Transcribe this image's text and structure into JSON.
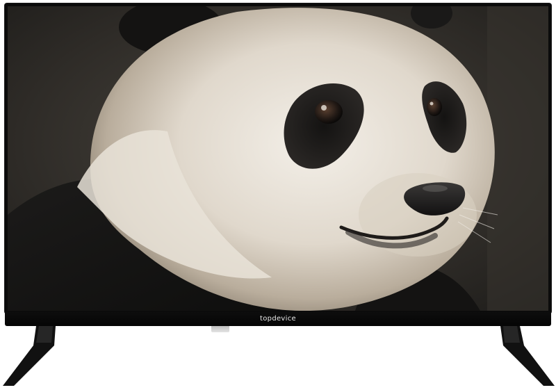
{
  "product": {
    "brand_logo": "topdevice"
  },
  "screen": {
    "subject": "panda-face-image"
  },
  "colors": {
    "frame": "#0b0b0b",
    "background": "#ffffff"
  }
}
